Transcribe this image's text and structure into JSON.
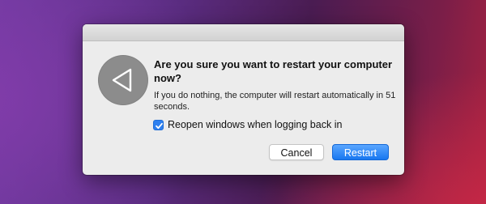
{
  "dialog": {
    "headline": "Are you sure you want to restart your computer now?",
    "info": "If you do nothing, the computer will restart automatically in 51 seconds.",
    "icon": "restart-icon",
    "checkbox": {
      "label": "Reopen windows when logging back in",
      "checked": true
    },
    "buttons": {
      "cancel": "Cancel",
      "confirm": "Restart"
    },
    "accent_color": "#2e80f0"
  }
}
